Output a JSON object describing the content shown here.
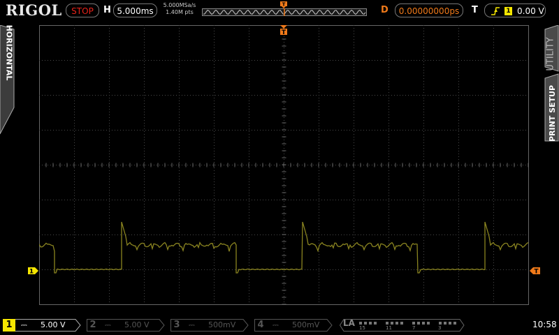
{
  "top_bar": {
    "logo": "RIGOL",
    "run_state": "STOP",
    "horizontal_letter": "H",
    "timebase": "5.000ms",
    "sample_rate": "5.000MSa/s",
    "memory_depth": "1.40M pts",
    "delay_letter": "D",
    "delay_value": "0.00000000ps",
    "trigger_letter": "T",
    "trigger_source": "1",
    "trigger_level": "0.00 V"
  },
  "side_tabs": {
    "left": "HORIZONTAL",
    "right_upper": "UTILITY",
    "right_lower": "PRINT SETUP"
  },
  "markers": {
    "channel1": "1",
    "trigger_position": "T",
    "trigger_level": "T"
  },
  "channels": [
    {
      "number": "1",
      "coupling": "⎓",
      "scale": "5.00 V",
      "color": "#f5e600",
      "active": true
    },
    {
      "number": "2",
      "coupling": "⎓",
      "scale": "5.00 V",
      "color": "#555555",
      "active": false
    },
    {
      "number": "3",
      "coupling": "⎓",
      "scale": "500mV",
      "color": "#555555",
      "active": false
    },
    {
      "number": "4",
      "coupling": "⎓",
      "scale": "500mV",
      "color": "#555555",
      "active": false
    }
  ],
  "logic_analyzer": {
    "label": "LA",
    "bit_labels": [
      "15",
      "11",
      "7",
      "3"
    ]
  },
  "clock": "10:58",
  "colors": {
    "channel1": "#f5e600",
    "trace": "#8a8420",
    "trigger": "#f07a1a",
    "stop": "#e8231a",
    "grid": "#3a3a3a"
  }
}
